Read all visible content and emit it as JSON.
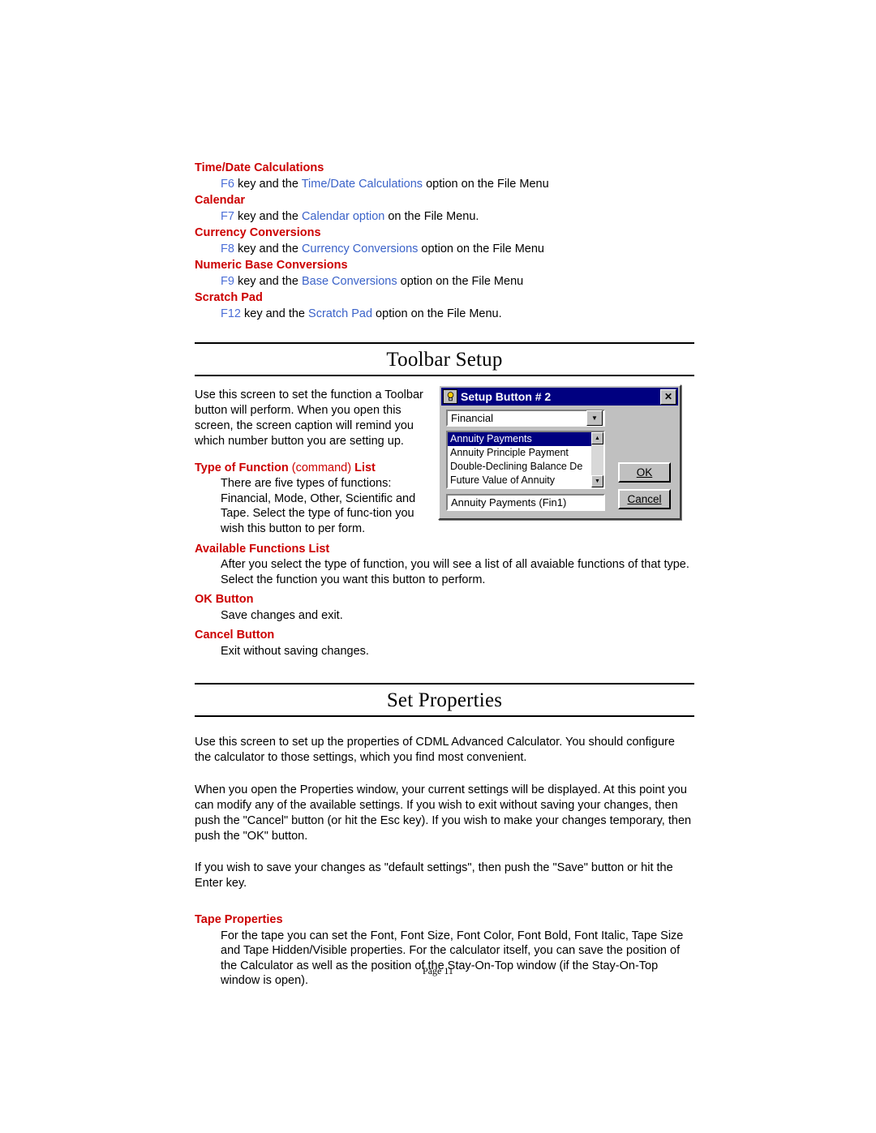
{
  "top_section": {
    "entries": [
      {
        "term": "Time/Date Calculations",
        "def_pre": "F6",
        "def_mid": " key and the ",
        "def_link": "Time/Date Calculations",
        "def_post": " option on the File Menu"
      },
      {
        "term": "Calendar",
        "def_pre": "F7",
        "def_mid": " key and the ",
        "def_link": "Calendar option",
        "def_post": " on the File Menu."
      },
      {
        "term": "Currency Conversions",
        "def_pre": "F8",
        "def_mid": " key and the ",
        "def_link": "Currency Conversions",
        "def_post": " option on the File Menu"
      },
      {
        "term": "Numeric Base Conversions",
        "def_pre": "F9",
        "def_mid": " key and the ",
        "def_link": "Base Conversions",
        "def_post": " option on the File Menu"
      },
      {
        "term": "Scratch Pad",
        "def_pre": "F12",
        "def_mid": " key and the ",
        "def_link": "Scratch Pad",
        "def_post": " option on the File Menu."
      }
    ]
  },
  "toolbar_setup": {
    "title": "Toolbar Setup",
    "intro": "Use this screen to set the function a Toolbar button will perform.  When you open this screen, the screen caption will remind you which number button you are setting up.",
    "items": [
      {
        "term_main": "Type of Function",
        "term_paren": "(command)",
        "term_tail": "List",
        "body": "There are five types of functions: Financial, Mode, Other, Scientific and Tape.  Select the type of func-tion you wish this button to per form."
      },
      {
        "term_main": "Available Functions List",
        "body": "After you select the type of function, you will see a list of all avaiable functions of that type. Select the function you want this button to perform."
      },
      {
        "term_main": "OK Button",
        "body": "Save changes and exit."
      },
      {
        "term_main": "Cancel Button",
        "body": "Exit without saving changes."
      }
    ]
  },
  "dialog": {
    "title": "Setup Button # 2",
    "icon": "lightbulb-icon",
    "close_label": "✕",
    "combo_value": "Financial",
    "combo_arrow": "▼",
    "list_items": [
      {
        "label": "Annuity Payments",
        "selected": true
      },
      {
        "label": "Annuity Principle Payment",
        "selected": false
      },
      {
        "label": "Double-Declining Balance De",
        "selected": false
      },
      {
        "label": "Future Value of Annuity",
        "selected": false
      }
    ],
    "scroll_up": "▲",
    "scroll_down": "▼",
    "text_value": "Annuity Payments (Fin1)",
    "ok_label": "OK",
    "cancel_label": "Cancel"
  },
  "set_properties": {
    "title": "Set Properties",
    "paragraphs": [
      "Use this screen to set up the properties of CDML Advanced Calculator.  You should configure the calculator to those settings, which you find most convenient.",
      "When you open the Properties window, your current settings will be displayed.  At this point you can modify any of the available settings.   If you wish to exit without saving your changes, then push the \"Cancel\"  button (or hit the Esc key).  If you wish to make your changes temporary, then push the \"OK\" button.",
      "If you wish to save your changes as \"default settings\", then push the \"Save\"  button or hit the Enter key."
    ],
    "tape_term": "Tape Properties",
    "tape_body": "For the tape you can set the Font, Font Size, Font Color, Font Bold, Font Italic, Tape Size and Tape Hidden/Visible properties.  For the calculator itself, you can save the position of the Calculator as well as the position of the Stay-On-Top window (if the Stay-On-Top window is open)."
  },
  "footer": {
    "page_label": "Page 11"
  }
}
